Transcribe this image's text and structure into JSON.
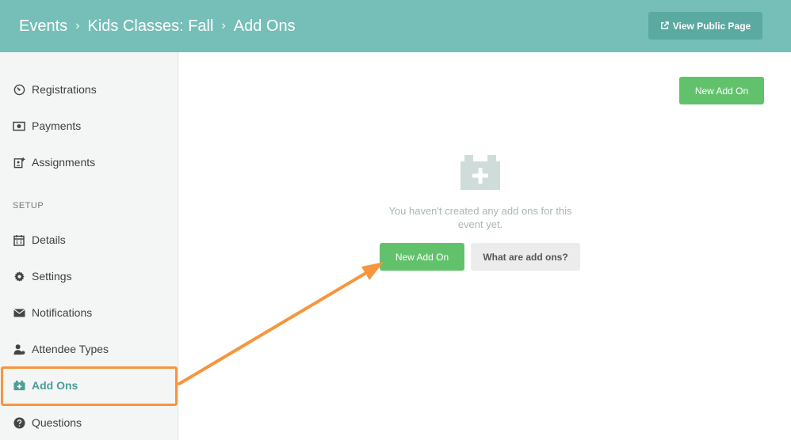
{
  "header": {
    "breadcrumb": [
      "Events",
      "Kids Classes: Fall",
      "Add Ons"
    ],
    "separator": "›",
    "view_public_label": "View Public Page"
  },
  "sidebar": {
    "items": [
      {
        "label": "Registrations",
        "icon": "gauge-icon"
      },
      {
        "label": "Payments",
        "icon": "money-icon"
      },
      {
        "label": "Assignments",
        "icon": "assignment-icon"
      }
    ],
    "section_label": "SETUP",
    "setup_items": [
      {
        "label": "Details",
        "icon": "calendar-icon"
      },
      {
        "label": "Settings",
        "icon": "gear-icon"
      },
      {
        "label": "Notifications",
        "icon": "envelope-icon"
      },
      {
        "label": "Attendee Types",
        "icon": "user-tie-icon"
      },
      {
        "label": "Add Ons",
        "icon": "medkit-icon",
        "active": true
      },
      {
        "label": "Questions",
        "icon": "question-circle-icon"
      }
    ]
  },
  "main": {
    "new_add_on_top_label": "New Add On",
    "empty_message": "You haven't created any add ons for this event yet.",
    "new_add_on_label": "New Add On",
    "what_are_label": "What are add ons?"
  },
  "colors": {
    "header": "#76bfb8",
    "accent": "#4a9e95",
    "green": "#62c26c",
    "highlight": "#f7953d"
  }
}
